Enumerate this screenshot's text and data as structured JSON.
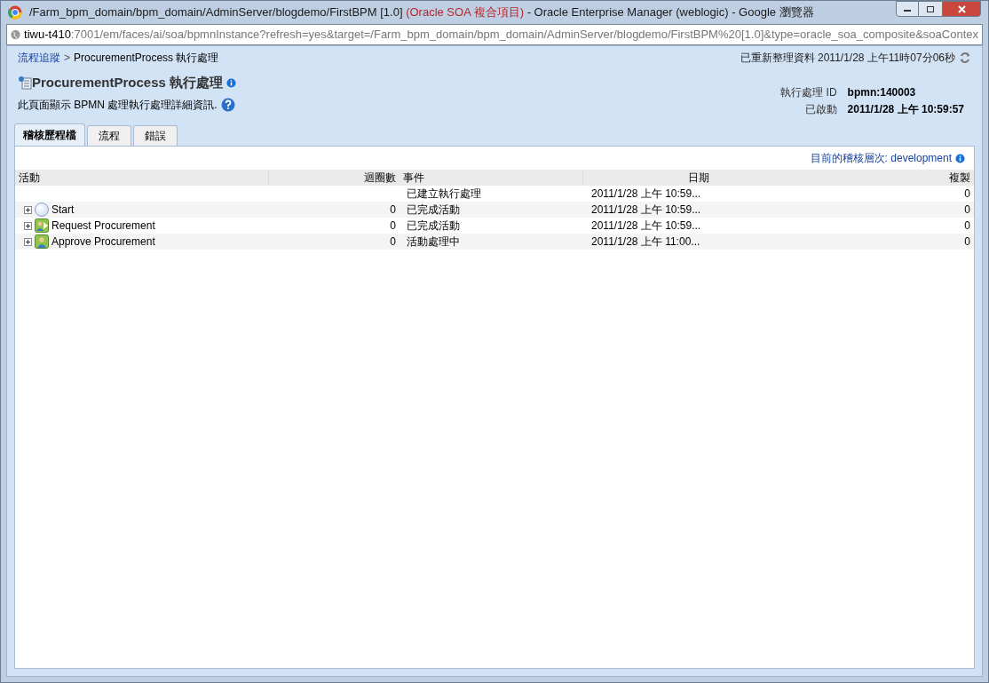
{
  "window": {
    "title_main": "/Farm_bpm_domain/bpm_domain/AdminServer/blogdemo/FirstBPM [1.0] ",
    "title_accent": "(Oracle SOA 複合項目)",
    "title_rest": " - Oracle Enterprise Manager (weblogic) - Google 瀏覽器"
  },
  "address_bar": {
    "host": "tiwu-t410",
    "path": ":7001/em/faces/ai/soa/bpmnInstance?refresh=yes&target=/Farm_bpm_domain/bpm_domain/AdminServer/blogdemo/FirstBPM%20[1.0]&type=oracle_soa_composite&soaContex"
  },
  "breadcrumb": {
    "link": "流程追蹤",
    "separator": ">",
    "current": "ProcurementProcess 執行處理"
  },
  "refreshed": "已重新整理資料 2011/1/28 上午11時07分06秒",
  "page_title": "ProcurementProcess 執行處理",
  "description": "此頁面顯示 BPMN 處理執行處理詳細資訊.",
  "details": [
    {
      "label": "執行處理 ID",
      "value": "bpmn:140003"
    },
    {
      "label": "已啟動",
      "value": "2011/1/28 上午 10:59:57"
    }
  ],
  "tabs": [
    {
      "label": "稽核歷程檔",
      "selected": true
    },
    {
      "label": "流程",
      "selected": false
    },
    {
      "label": "錯誤",
      "selected": false
    }
  ],
  "audit_level": "目前的稽核層次: development",
  "table": {
    "columns": [
      "活動",
      "迴圈數",
      "事件",
      "日期",
      "複製"
    ],
    "rows": [
      {
        "kind": "none",
        "activity": "",
        "loops": "",
        "event": "已建立執行處理",
        "date": "2011/1/28 上午 10:59...",
        "copy": "0"
      },
      {
        "kind": "start",
        "activity": "Start",
        "loops": "0",
        "event": "已完成活動",
        "date": "2011/1/28 上午 10:59...",
        "copy": "0"
      },
      {
        "kind": "task",
        "activity": "Request Procurement",
        "loops": "0",
        "event": "已完成活動",
        "date": "2011/1/28 上午 10:59...",
        "copy": "0"
      },
      {
        "kind": "user",
        "activity": "Approve Procurement",
        "loops": "0",
        "event": "活動處理中",
        "date": "2011/1/28 上午 11:00...",
        "copy": "0"
      }
    ]
  }
}
